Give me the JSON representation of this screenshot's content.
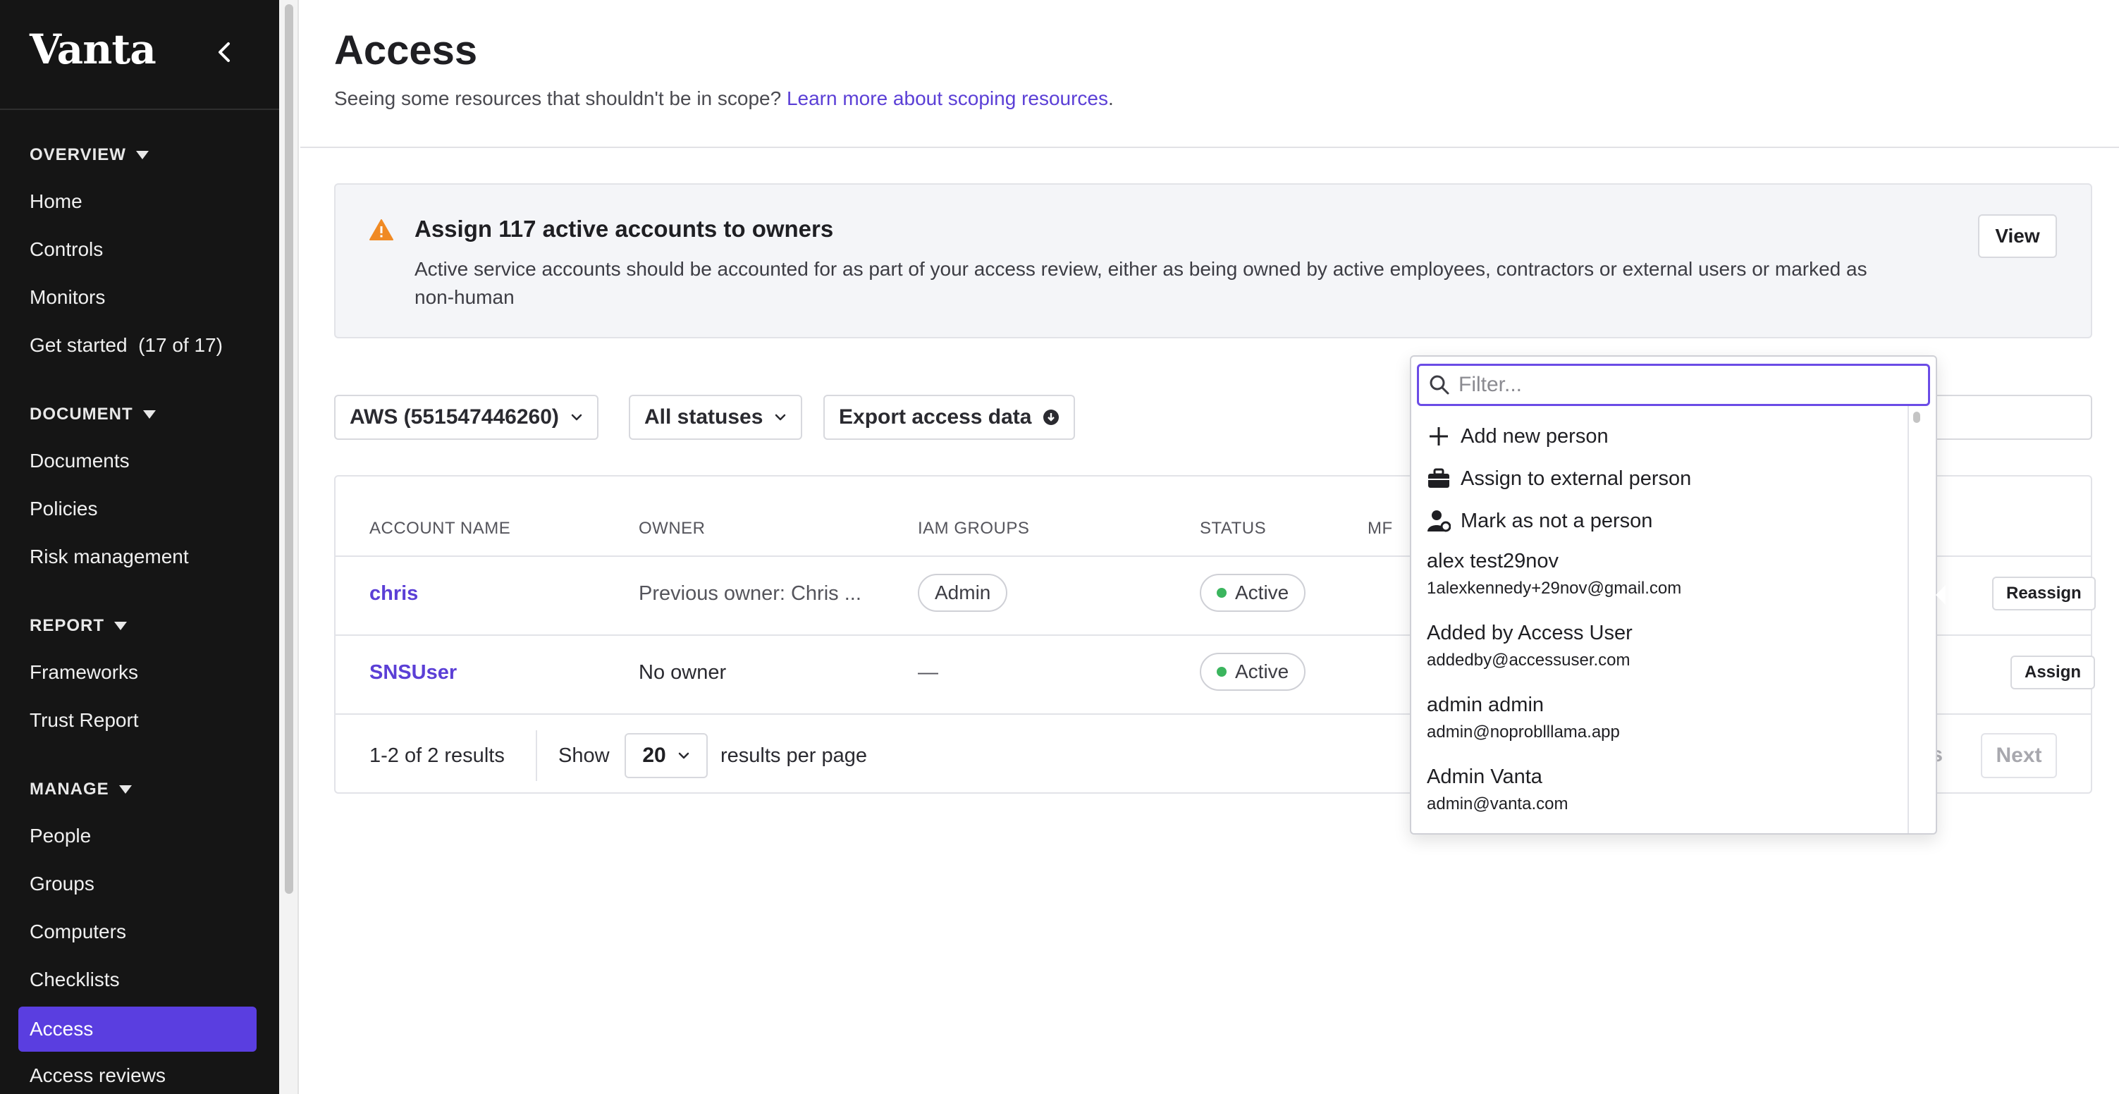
{
  "sidebar": {
    "brand": "Vanta",
    "sections": [
      {
        "title": "OVERVIEW",
        "items": [
          "Home",
          "Controls",
          "Monitors",
          "Get started  (17 of 17)"
        ]
      },
      {
        "title": "DOCUMENT",
        "items": [
          "Documents",
          "Policies",
          "Risk management"
        ]
      },
      {
        "title": "REPORT",
        "items": [
          "Frameworks",
          "Trust Report"
        ]
      },
      {
        "title": "MANAGE",
        "items": [
          "People",
          "Groups",
          "Computers",
          "Checklists",
          "Access",
          "Access reviews"
        ]
      }
    ],
    "active_item": "Access"
  },
  "header": {
    "title": "Access",
    "subtitle_prefix": "Seeing some resources that shouldn't be in scope?",
    "subtitle_link": "Learn more about scoping resources",
    "subtitle_suffix": "."
  },
  "banner": {
    "title": "Assign 117 active accounts to owners",
    "description": "Active service accounts should be accounted for as part of your access review, either as being owned by active employees, contractors or external users or marked as non-human",
    "button": "View",
    "icon": "warning-icon",
    "color": "#f08a24"
  },
  "filters": {
    "account": "AWS (551547446260)",
    "status": "All statuses",
    "export": "Export access data"
  },
  "table": {
    "headers": [
      "ACCOUNT NAME",
      "OWNER",
      "IAM GROUPS",
      "STATUS",
      "MF"
    ],
    "rows": [
      {
        "name": "chris",
        "owner": "Previous owner: Chris ...",
        "groups": "Admin",
        "status": "Active",
        "action": "Reassign"
      },
      {
        "name": "SNSUser",
        "owner": "No owner",
        "groups": "—",
        "status": "Active",
        "action": "Assign"
      }
    ],
    "footer": {
      "results": "1-2 of 2 results",
      "show": "Show",
      "per_page": "20",
      "per_page_suffix": "results per page",
      "prev_fragment": "s",
      "next": "Next"
    }
  },
  "dropdown": {
    "placeholder": "Filter...",
    "actions": [
      {
        "label": "Add new person",
        "icon": "plus-icon"
      },
      {
        "label": "Assign to external person",
        "icon": "briefcase-icon"
      },
      {
        "label": "Mark as not a person",
        "icon": "user-cog-icon"
      }
    ],
    "people": [
      {
        "name": "alex test29nov",
        "email": "1alexkennedy+29nov@gmail.com"
      },
      {
        "name": "Added by Access User",
        "email": "addedby@accessuser.com"
      },
      {
        "name": "admin admin",
        "email": "admin@noproblllama.app"
      },
      {
        "name": "Admin Vanta",
        "email": "admin@vanta.com"
      }
    ]
  },
  "colors": {
    "accent": "#5a3ee0",
    "link": "#5b3fd6",
    "active_status": "#3bb55e"
  }
}
